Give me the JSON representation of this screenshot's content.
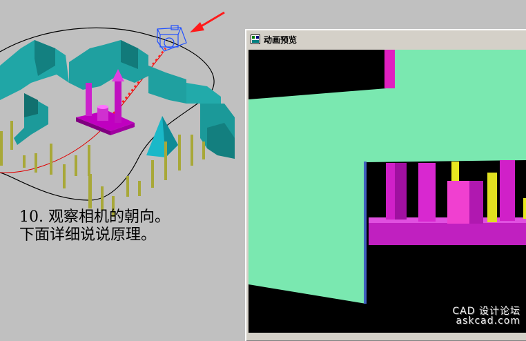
{
  "caption": {
    "line1": "10. 观察相机的朝向。",
    "line2": "下面详细说说原理。"
  },
  "preview_window": {
    "title": "动画预览",
    "icon": "app-window-icon"
  },
  "watermark": {
    "line1": "CAD 设计论坛",
    "line2": "askcad.com"
  },
  "colors": {
    "background": "#c0c0c0",
    "wall_cyan": "#20a6a6",
    "object_magenta": "#c000c0",
    "pole_olive": "#a8a838",
    "preview_green": "#7ae8b0",
    "camera_blue": "#2050ff",
    "arrow_red": "#ff2020"
  },
  "icons": [
    "camera-icon",
    "red-arrow-icon"
  ]
}
